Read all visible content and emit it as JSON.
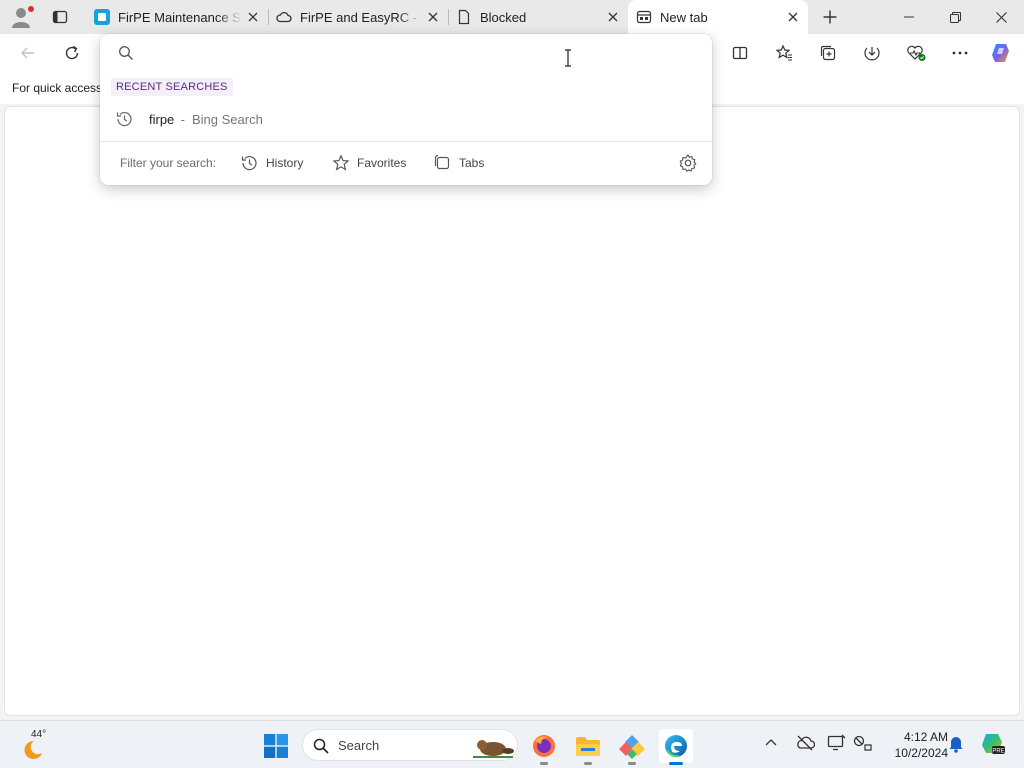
{
  "browser": {
    "tabs": [
      {
        "title": "FirPE Maintenance Sys",
        "icon": "firpe-app-icon"
      },
      {
        "title": "FirPE and EasyRC - hu",
        "icon": "cloud-icon"
      },
      {
        "title": "Blocked",
        "icon": "page-icon"
      },
      {
        "title": "New tab",
        "icon": "new-tab-icon",
        "active": true
      }
    ],
    "new_tab_symbol": "+",
    "favorites_bar_text": "For quick access"
  },
  "omnibox": {
    "value": "",
    "recent_searches_header": "RECENT SEARCHES",
    "suggestions": [
      {
        "query": "firpe",
        "separator": " - ",
        "source": "Bing Search"
      }
    ],
    "filter_label": "Filter your search:",
    "filters": [
      "History",
      "Favorites",
      "Tabs"
    ]
  },
  "taskbar": {
    "weather_temp": "44°",
    "search_label": "Search",
    "time": "4:12 AM",
    "date": "10/2/2024"
  },
  "colors": {
    "accent": "#0078d4",
    "header_bg": "#f3f0fa",
    "header_text": "#5b2b86"
  }
}
